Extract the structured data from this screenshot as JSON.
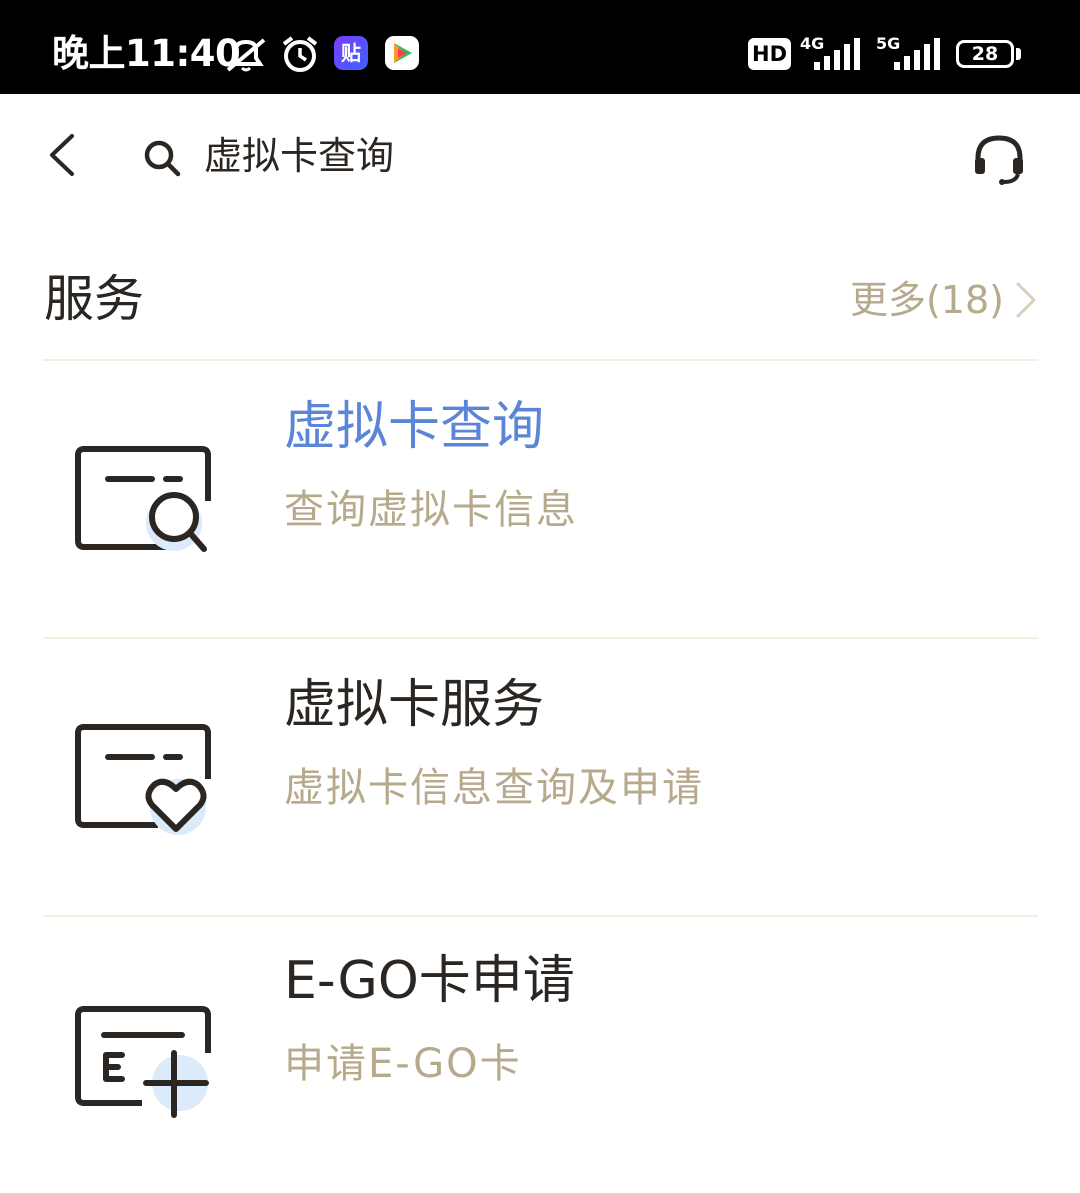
{
  "status_bar": {
    "time": "晚上11:40",
    "tie_badge": "贴",
    "hd_label": "HD",
    "net_4g": "4G",
    "net_5g": "5G",
    "battery": "28"
  },
  "header": {
    "search_query": "虚拟卡查询"
  },
  "section": {
    "title": "服务",
    "more_label": "更多(18)"
  },
  "items": [
    {
      "title": "虚拟卡查询",
      "desc": "查询虚拟卡信息",
      "icon": "card-search-icon"
    },
    {
      "title": "虚拟卡服务",
      "desc": "虚拟卡信息查询及申请",
      "icon": "card-heart-icon"
    },
    {
      "title": "E-GO卡申请",
      "desc": "申请E-GO卡",
      "icon": "card-add-icon"
    }
  ],
  "colors": {
    "active_title": "#5b86d8",
    "muted_text": "#b6a98c",
    "primary_text": "#2b2621",
    "divider": "#f6eedf"
  }
}
